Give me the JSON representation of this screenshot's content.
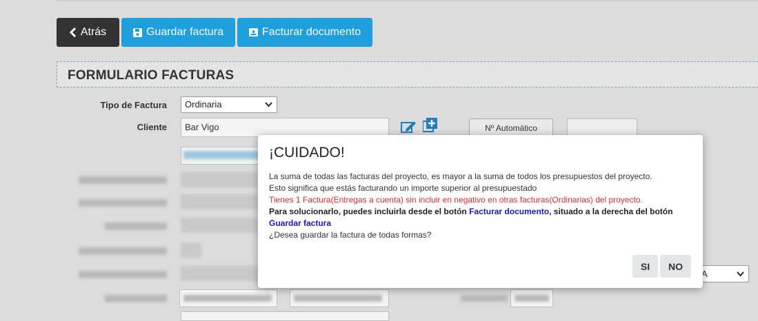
{
  "toolbar": {
    "back_label": "Atrás",
    "save_label": "Guardar factura",
    "bill_label": "Facturar documento"
  },
  "form": {
    "title": "FORMULARIO FACTURAS",
    "tipo_label": "Tipo de Factura",
    "tipo_value": "Ordinaria",
    "cliente_label": "Cliente",
    "cliente_value": "Bar Vigo",
    "auto_number_label": "Nº Automático",
    "right_select_value": "A"
  },
  "icons": {
    "back": "chevron-left-icon",
    "save": "floppy-disk-icon",
    "bill": "invoice-icon",
    "edit": "edit-icon",
    "add": "add-square-icon"
  },
  "colors": {
    "primary": "#1fa0dd",
    "dark_button": "#333333",
    "warning_text": "#e12a2a",
    "link_text": "#1717c9"
  },
  "modal": {
    "title": "¡CUIDADO!",
    "line1": "La suma de todas las facturas del proyecto, es mayor a la suma de todos los presupuestos del proyecto.",
    "line2": "Esto significa que estás facturando un importe superior al presupuestado",
    "line3": "Tienes 1 Factura(Entregas a cuenta) sin incluir en negativo en otras facturas(Ordinarias) del proyecto.",
    "line4_a": "Para solucionarlo, puedes incluirla desde el botón ",
    "line4_link1": "Facturar documento",
    "line4_b": ", situado a la derecha del botón ",
    "line4_link2": "Guardar factura",
    "line5": "¿Desea guardar la factura de todas formas?",
    "yes_label": "SI",
    "no_label": "NO"
  }
}
